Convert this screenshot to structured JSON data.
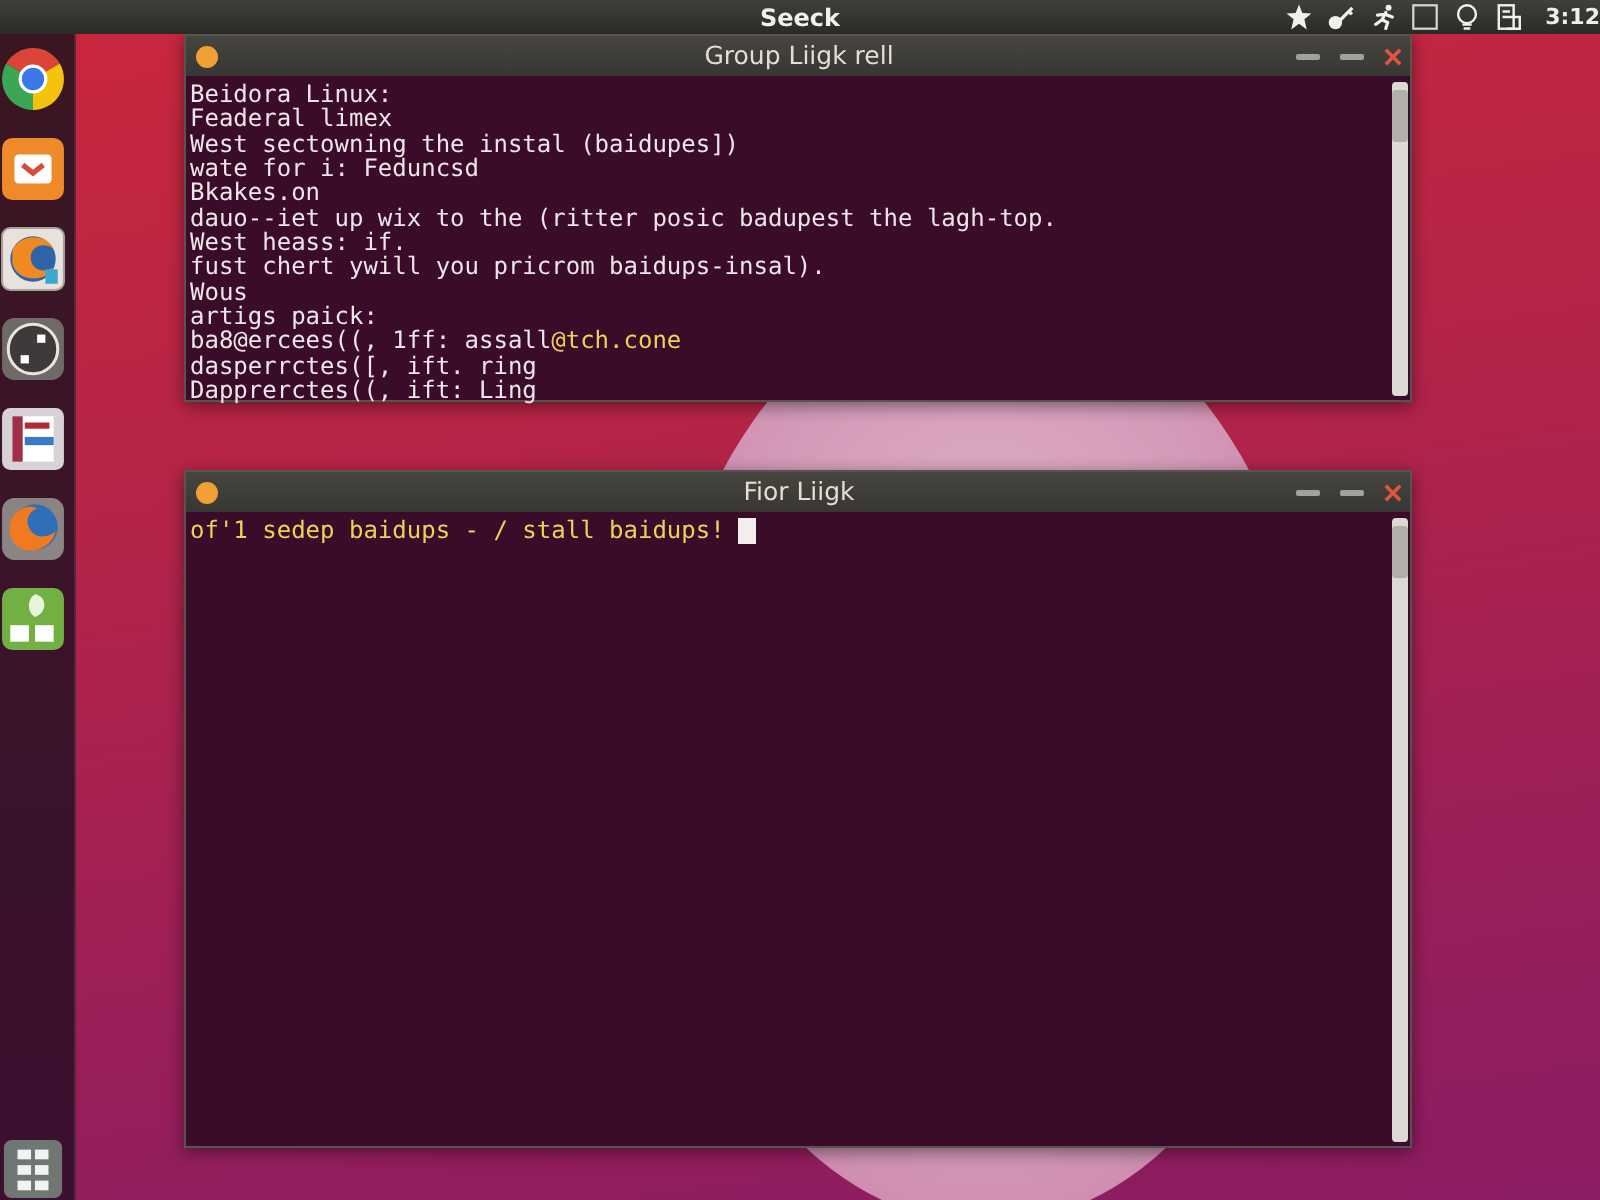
{
  "top_panel": {
    "title": "Seeck",
    "indicators": [
      {
        "kind": "star"
      },
      {
        "kind": "key"
      },
      {
        "kind": "runner"
      },
      {
        "kind": "square"
      },
      {
        "kind": "bulb"
      },
      {
        "kind": "document"
      }
    ],
    "clock": "3:12"
  },
  "launcher": {
    "items": [
      {
        "kind": "wheel"
      },
      {
        "kind": "tray"
      },
      {
        "kind": "globe"
      },
      {
        "kind": "dial"
      },
      {
        "kind": "document"
      },
      {
        "kind": "fox"
      },
      {
        "kind": "plant"
      }
    ]
  },
  "windows": [
    {
      "title": "Group Liigk rell",
      "cursor": false,
      "lines": [
        {
          "parts": [
            {
              "text": "Beidora Linux:",
              "kind": "plain"
            }
          ]
        },
        {
          "parts": [
            {
              "text": "Feaderal limex",
              "kind": "plain"
            }
          ]
        },
        {
          "parts": [
            {
              "text": "West sectowning the instal (baidupes])",
              "kind": "plain"
            }
          ]
        },
        {
          "parts": [
            {
              "text": "wate for i: Feduncsd",
              "kind": "plain"
            }
          ]
        },
        {
          "parts": [
            {
              "text": "Bkakes.on",
              "kind": "plain"
            }
          ]
        },
        {
          "parts": [
            {
              "text": "dauo--iet up wix to the (ritter posic badupest the lagh-top.",
              "kind": "plain"
            }
          ]
        },
        {
          "parts": [
            {
              "text": "West heass: if.",
              "kind": "plain"
            }
          ]
        },
        {
          "parts": [
            {
              "text": "fust chert ywill you pricrom baidups-insal).",
              "kind": "plain"
            }
          ]
        },
        {
          "parts": [
            {
              "text": "Wous",
              "kind": "plain"
            }
          ]
        },
        {
          "parts": [
            {
              "text": "artigs paick:",
              "kind": "plain"
            }
          ]
        },
        {
          "parts": [
            {
              "text": "ba8@ercees((, 1ff: assall",
              "kind": "plain"
            },
            {
              "text": "@tch.cone",
              "kind": "accent"
            }
          ]
        },
        {
          "parts": [
            {
              "text": "dasperrctes([, ift. ring",
              "kind": "plain"
            }
          ]
        },
        {
          "parts": [
            {
              "text": "Dapprerctes((, ift: Ling",
              "kind": "plain"
            }
          ]
        }
      ]
    },
    {
      "title": "Fior Liigk",
      "cursor": true,
      "lines": [
        {
          "parts": [
            {
              "text": "of'1 sedep baidups - / stall baidups!",
              "kind": "accent"
            }
          ]
        }
      ]
    }
  ]
}
